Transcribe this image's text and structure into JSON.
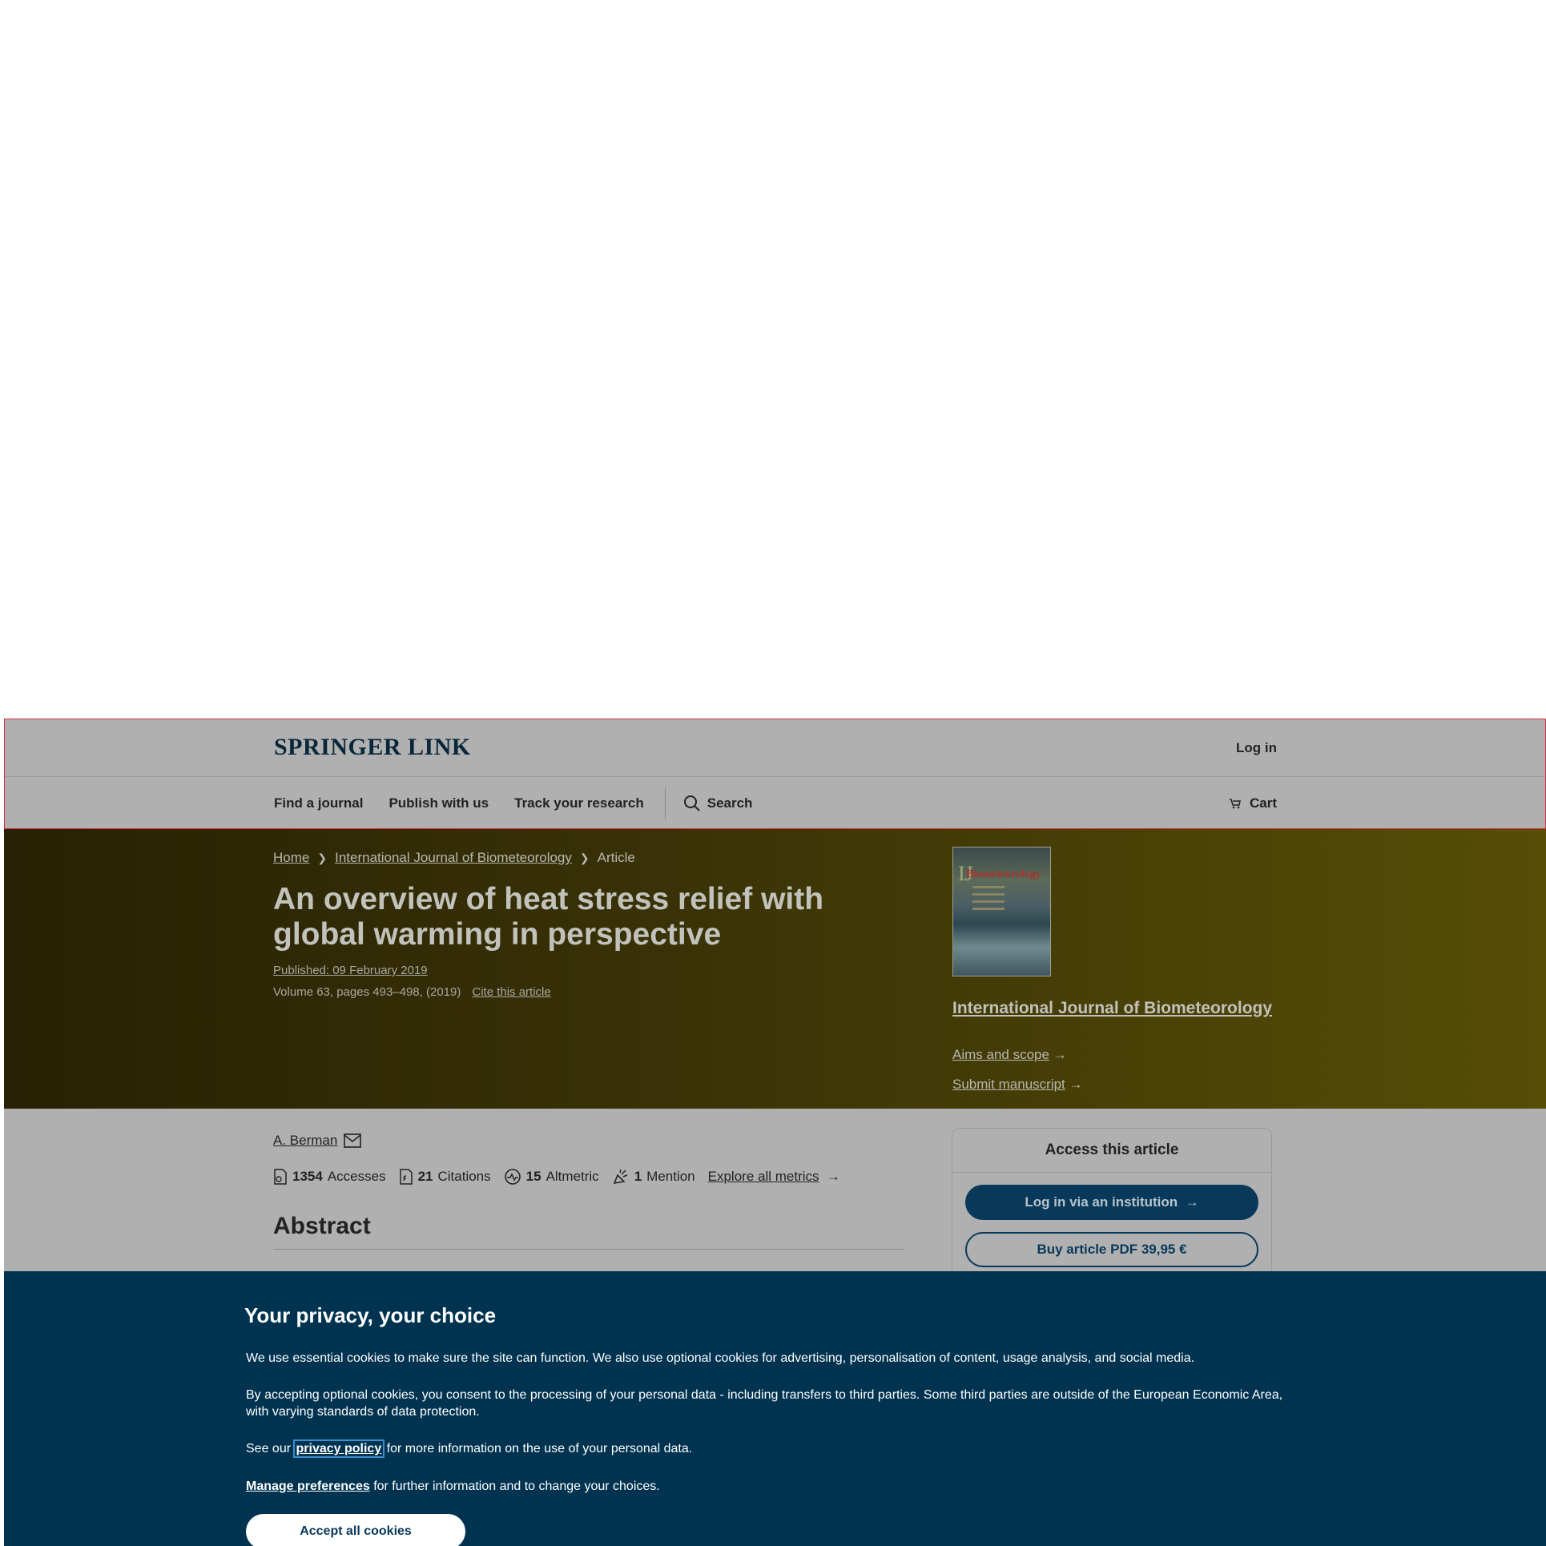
{
  "header": {
    "logo": "SPRINGER LINK",
    "login": "Log in",
    "nav": [
      "Find a journal",
      "Publish with us",
      "Track your research"
    ],
    "search": "Search",
    "cart": "Cart"
  },
  "breadcrumb": {
    "home": "Home",
    "journal": "International Journal of Biometeorology",
    "current": "Article"
  },
  "article": {
    "title": "An overview of heat stress relief with global warming in perspective",
    "published": "Published: 09 February 2019",
    "volume": "Volume 63, pages 493–498, (2019)",
    "cite": "Cite this article"
  },
  "journal_sidebar": {
    "cover_ij": "IJ",
    "cover_title": "Biometeorology",
    "name": "International Journal of Biometeorology",
    "aims": "Aims and scope",
    "submit": "Submit manuscript"
  },
  "author": "A. Berman",
  "metrics": {
    "accesses_value": "1354",
    "accesses_label": "Accesses",
    "citations_value": "21",
    "citations_label": "Citations",
    "altmetric_value": "15",
    "altmetric_label": "Altmetric",
    "mention_value": "1",
    "mention_label": "Mention",
    "explore": "Explore all metrics"
  },
  "abstract_heading": "Abstract",
  "access_box": {
    "title": "Access this article",
    "institution_button": "Log in via an institution",
    "buy_button": "Buy article PDF 39,95 €"
  },
  "cookie": {
    "title": "Your privacy, your choice",
    "p1": "We use essential cookies to make sure the site can function. We also use optional cookies for advertising, personalisation of content, usage analysis, and social media.",
    "p2": "By accepting optional cookies, you consent to the processing of your personal data - including transfers to third parties. Some third parties are outside of the European Economic Area, with varying standards of data protection.",
    "p3_pre": "See our",
    "p3_link": "privacy policy",
    "p3_post": "for more information on the use of your personal data.",
    "p4_link": "Manage preferences",
    "p4_post": "for further information and to change your choices.",
    "accept": "Accept all cookies"
  }
}
